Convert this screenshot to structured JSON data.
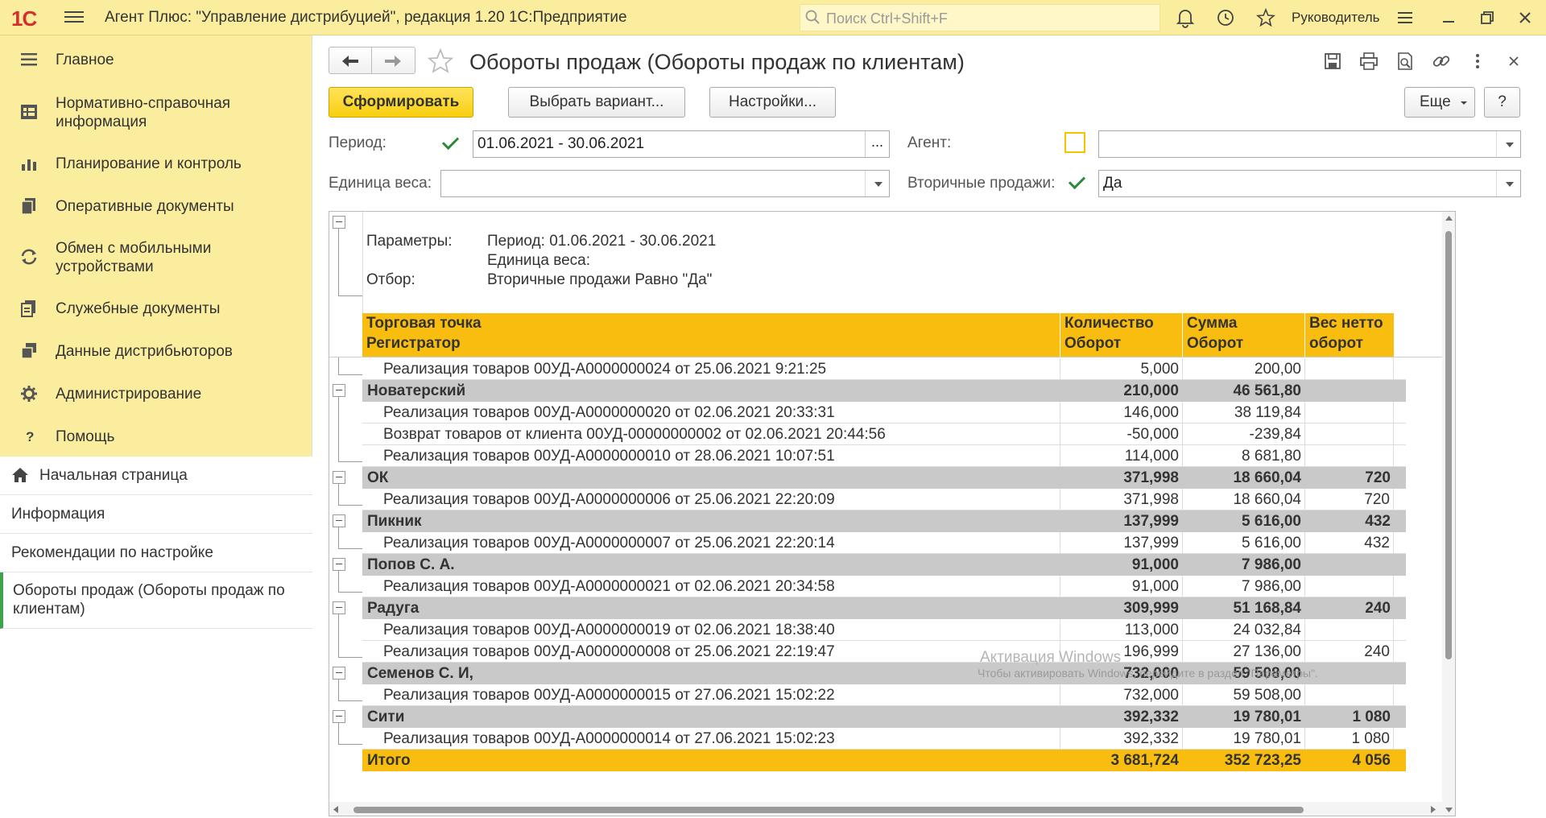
{
  "topbar": {
    "logo": "1С",
    "app_title": "Агент Плюс: \"Управление дистрибуцией\", редакция 1.20 1С:Предприятие",
    "search_placeholder": "Поиск Ctrl+Shift+F",
    "user": "Руководитель"
  },
  "sidebar": {
    "sections": [
      {
        "label": "Главное",
        "icon": "menu-lines-icon"
      },
      {
        "label": "Нормативно-справочная информация",
        "icon": "reference-table-icon"
      },
      {
        "label": "Планирование и контроль",
        "icon": "bar-chart-icon"
      },
      {
        "label": "Оперативные документы",
        "icon": "documents-icon"
      },
      {
        "label": "Обмен с мобильными устройствами",
        "icon": "sync-icon"
      },
      {
        "label": "Служебные документы",
        "icon": "service-docs-icon"
      },
      {
        "label": "Данные дистрибьюторов",
        "icon": "distributor-data-icon"
      },
      {
        "label": "Администрирование",
        "icon": "gear-icon"
      },
      {
        "label": "Помощь",
        "icon": "question-icon"
      }
    ],
    "nav": [
      {
        "label": "Начальная страница",
        "icon": "home-icon"
      },
      {
        "label": "Информация"
      },
      {
        "label": "Рекомендации по настройке"
      },
      {
        "label": "Обороты продаж (Обороты продаж по клиентам)",
        "active": true
      }
    ]
  },
  "form": {
    "title": "Обороты продаж (Обороты продаж по клиентам)",
    "buttons": {
      "generate": "Сформировать",
      "choose_variant": "Выбрать вариант...",
      "settings": "Настройки...",
      "more": "Еще",
      "help": "?"
    },
    "filters": {
      "period_label": "Период:",
      "period_checked": true,
      "period_value": "01.06.2021 - 30.06.2021",
      "period_button": "...",
      "agent_label": "Агент:",
      "agent_checked": false,
      "agent_value": "",
      "weight_unit_label": "Единица веса:",
      "weight_unit_value": "",
      "secondary_label": "Вторичные продажи:",
      "secondary_checked": true,
      "secondary_value": "Да"
    }
  },
  "report": {
    "params_label": "Параметры:",
    "params_period": "Период: 01.06.2021 - 30.06.2021",
    "params_weight": "Единица веса:",
    "filter_label": "Отбор:",
    "filter_value": "Вторичные продажи Равно \"Да\"",
    "header": {
      "col0_line1": "Торговая точка",
      "col0_line2": "Регистратор",
      "col1_line1": "Количество",
      "col1_line2": "Оборот",
      "col2_line1": "Сумма",
      "col2_line2": "Оборот",
      "col3_line1": "Вес нетто",
      "col3_line2": "оборот"
    },
    "rows": [
      {
        "type": "detail",
        "name": "Реализация товаров 00УД-А0000000024 от 25.06.2021 9:21:25",
        "qty": "5,000",
        "sum": "200,00",
        "weight": ""
      },
      {
        "type": "group",
        "name": "Новатерский",
        "qty": "210,000",
        "sum": "46 561,80",
        "weight": ""
      },
      {
        "type": "detail",
        "name": "Реализация товаров 00УД-А0000000020 от 02.06.2021 20:33:31",
        "qty": "146,000",
        "sum": "38 119,84",
        "weight": ""
      },
      {
        "type": "detail",
        "name": "Возврат товаров от клиента 00УД-00000000002 от 02.06.2021 20:44:56",
        "qty": "-50,000",
        "sum": "-239,84",
        "weight": ""
      },
      {
        "type": "detail",
        "name": "Реализация товаров 00УД-А0000000010 от 28.06.2021 10:07:51",
        "qty": "114,000",
        "sum": "8 681,80",
        "weight": ""
      },
      {
        "type": "group",
        "name": "ОК",
        "qty": "371,998",
        "sum": "18 660,04",
        "weight": "720"
      },
      {
        "type": "detail",
        "name": "Реализация товаров 00УД-А0000000006 от 25.06.2021 22:20:09",
        "qty": "371,998",
        "sum": "18 660,04",
        "weight": "720"
      },
      {
        "type": "group",
        "name": "Пикник",
        "qty": "137,999",
        "sum": "5 616,00",
        "weight": "432"
      },
      {
        "type": "detail",
        "name": "Реализация товаров 00УД-А0000000007 от 25.06.2021 22:20:14",
        "qty": "137,999",
        "sum": "5 616,00",
        "weight": "432"
      },
      {
        "type": "group",
        "name": "Попов С. А.",
        "qty": "91,000",
        "sum": "7 986,00",
        "weight": ""
      },
      {
        "type": "detail",
        "name": "Реализация товаров 00УД-А0000000021 от 02.06.2021 20:34:58",
        "qty": "91,000",
        "sum": "7 986,00",
        "weight": ""
      },
      {
        "type": "group",
        "name": "Радуга",
        "qty": "309,999",
        "sum": "51 168,84",
        "weight": "240"
      },
      {
        "type": "detail",
        "name": "Реализация товаров 00УД-А0000000019 от 02.06.2021 18:38:40",
        "qty": "113,000",
        "sum": "24 032,84",
        "weight": ""
      },
      {
        "type": "detail",
        "name": "Реализация товаров 00УД-А0000000008 от 25.06.2021 22:19:47",
        "qty": "196,999",
        "sum": "27 136,00",
        "weight": "240"
      },
      {
        "type": "group",
        "name": "Семенов С. И,",
        "qty": "732,000",
        "sum": "59 508,00",
        "weight": ""
      },
      {
        "type": "detail",
        "name": "Реализация товаров 00УД-А0000000015 от 27.06.2021 15:02:22",
        "qty": "732,000",
        "sum": "59 508,00",
        "weight": ""
      },
      {
        "type": "group",
        "name": "Сити",
        "qty": "392,332",
        "sum": "19 780,01",
        "weight": "1 080"
      },
      {
        "type": "detail",
        "name": "Реализация товаров 00УД-А0000000014 от 27.06.2021 15:02:23",
        "qty": "392,332",
        "sum": "19 780,01",
        "weight": "1 080"
      },
      {
        "type": "total",
        "name": "Итого",
        "qty": "3 681,724",
        "sum": "352 723,25",
        "weight": "4 056"
      }
    ],
    "watermark_title": "Активация Windows",
    "watermark_text": "Чтобы активировать Windows, перейдите в раздел \"Параметры\"."
  },
  "colors": {
    "accent_yellow": "#fbed9e",
    "header_orange": "#f9bd10",
    "group_gray": "#c9c9c9",
    "active_green": "#3da24a"
  }
}
